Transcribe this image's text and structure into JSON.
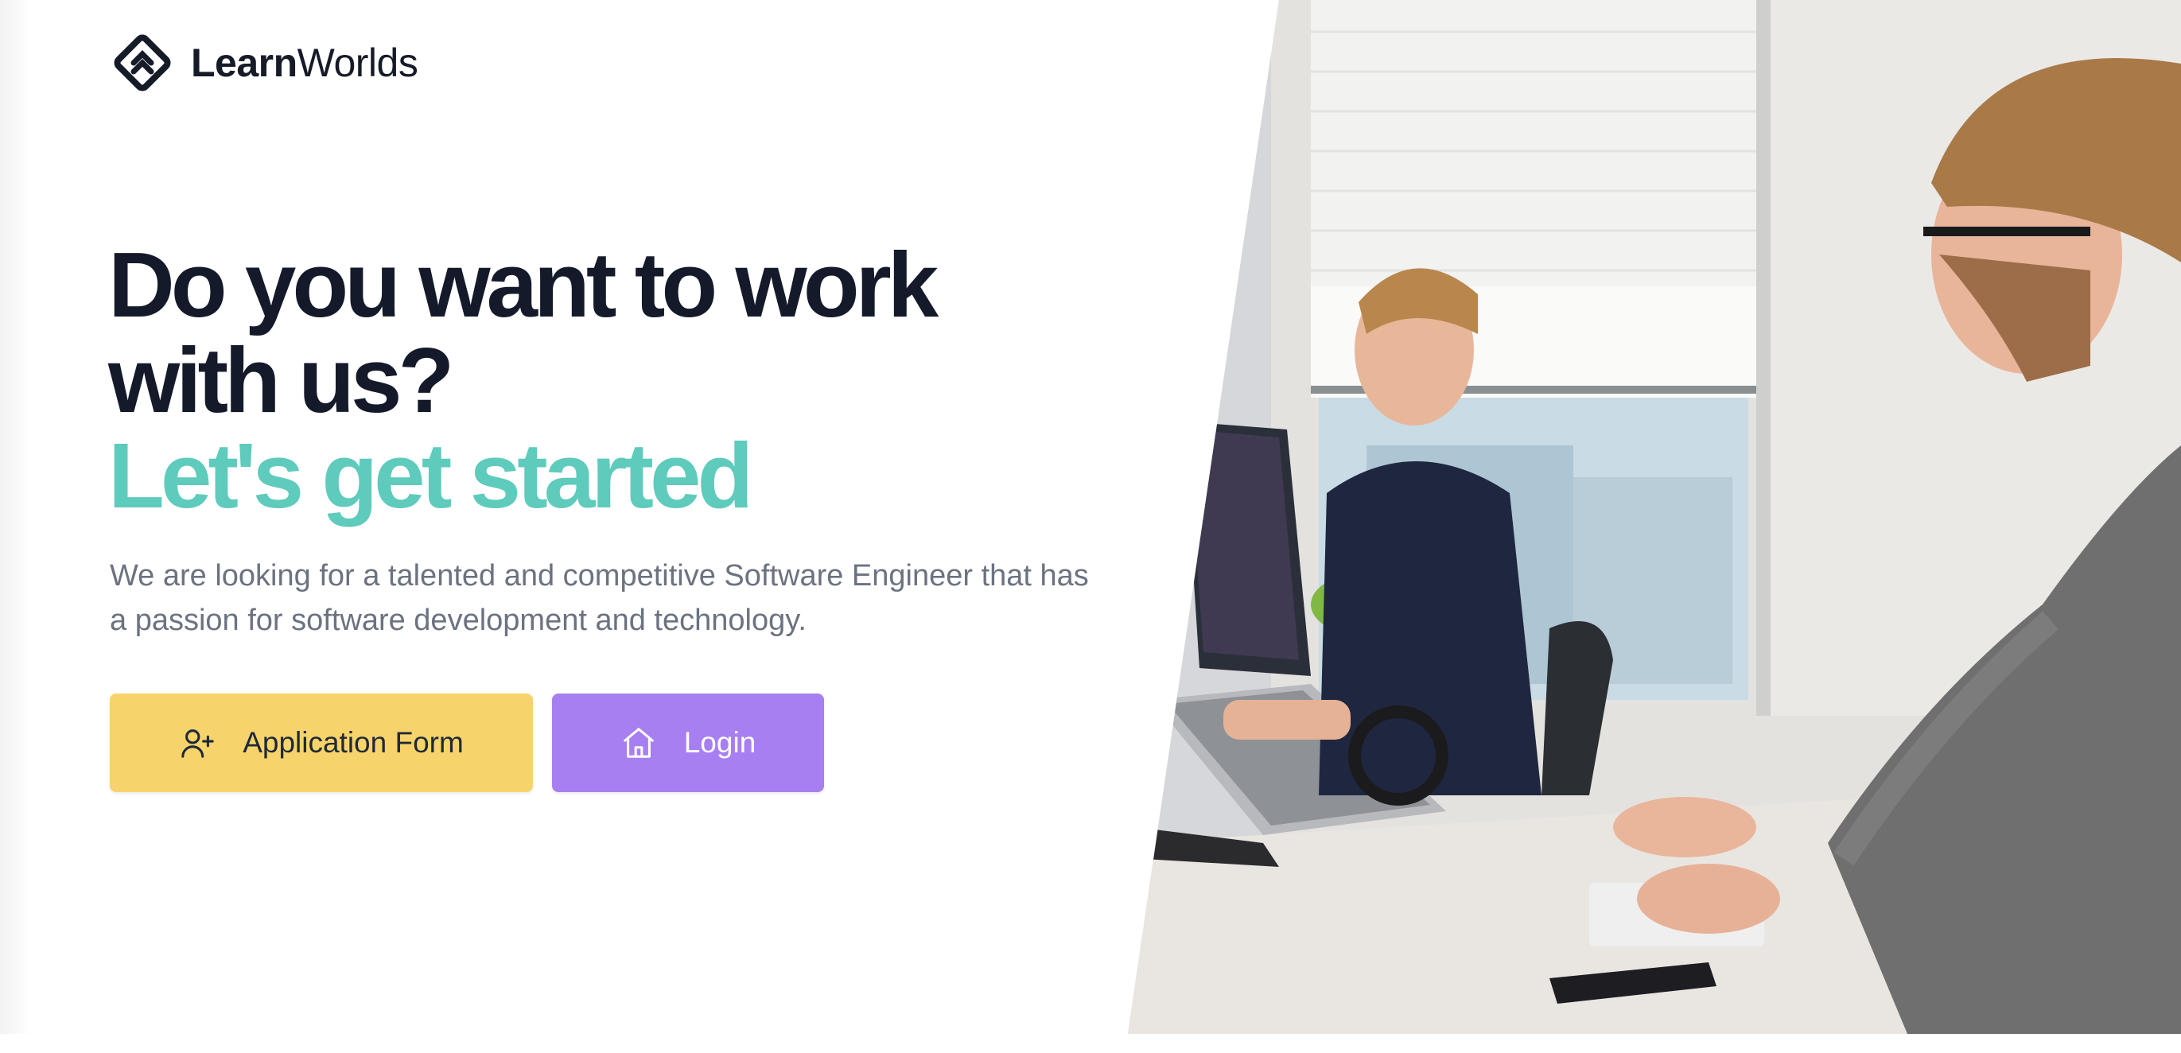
{
  "brand": {
    "name_bold": "Learn",
    "name_light": "Worlds",
    "logo_icon": "learnworlds-diamond-logo"
  },
  "hero": {
    "headline_line1": "Do you want to work",
    "headline_line2": "with us?",
    "headline_accent": "Let's get started",
    "description": "We are looking for a talented and competitive Software Engineer that has a passion for software development and technology."
  },
  "actions": {
    "application": {
      "label": "Application Form",
      "icon": "user-plus-icon",
      "color": "#f7d36b"
    },
    "login": {
      "label": "Login",
      "icon": "home-icon",
      "color": "#a77ff0"
    }
  },
  "colors": {
    "headline": "#151a2b",
    "accent": "#5ecbbc",
    "body_text": "#6b7280"
  }
}
